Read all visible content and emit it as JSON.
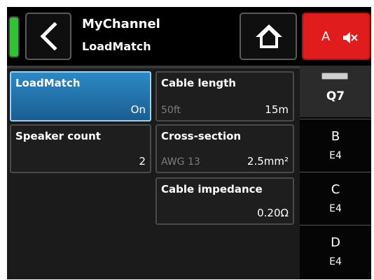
{
  "header": {
    "title": "MyChannel",
    "subtitle": "LoadMatch",
    "mute_label": "A",
    "icons": [
      "back-arrow-icon",
      "home-icon",
      "speaker-mute-icon"
    ],
    "colors": {
      "status_led": "#35c135",
      "mute_button": "#e11c1c",
      "active_tile": "#2477b3"
    }
  },
  "tiles": {
    "loadmatch": {
      "title": "LoadMatch",
      "value": "On",
      "active": true
    },
    "cable_length": {
      "title": "Cable length",
      "secondary": "50ft",
      "value": "15m"
    },
    "speaker_count": {
      "title": "Speaker count",
      "value": "2"
    },
    "cross_section": {
      "title": "Cross-section",
      "secondary": "AWG 13",
      "value": "2.5mm²"
    },
    "cable_impedance": {
      "title": "Cable impedance",
      "value": "0.20Ω"
    }
  },
  "channels": {
    "current": "Q7",
    "items": [
      {
        "name": "B",
        "mode": "E4"
      },
      {
        "name": "C",
        "mode": "E4"
      },
      {
        "name": "D",
        "mode": "E4"
      }
    ]
  }
}
